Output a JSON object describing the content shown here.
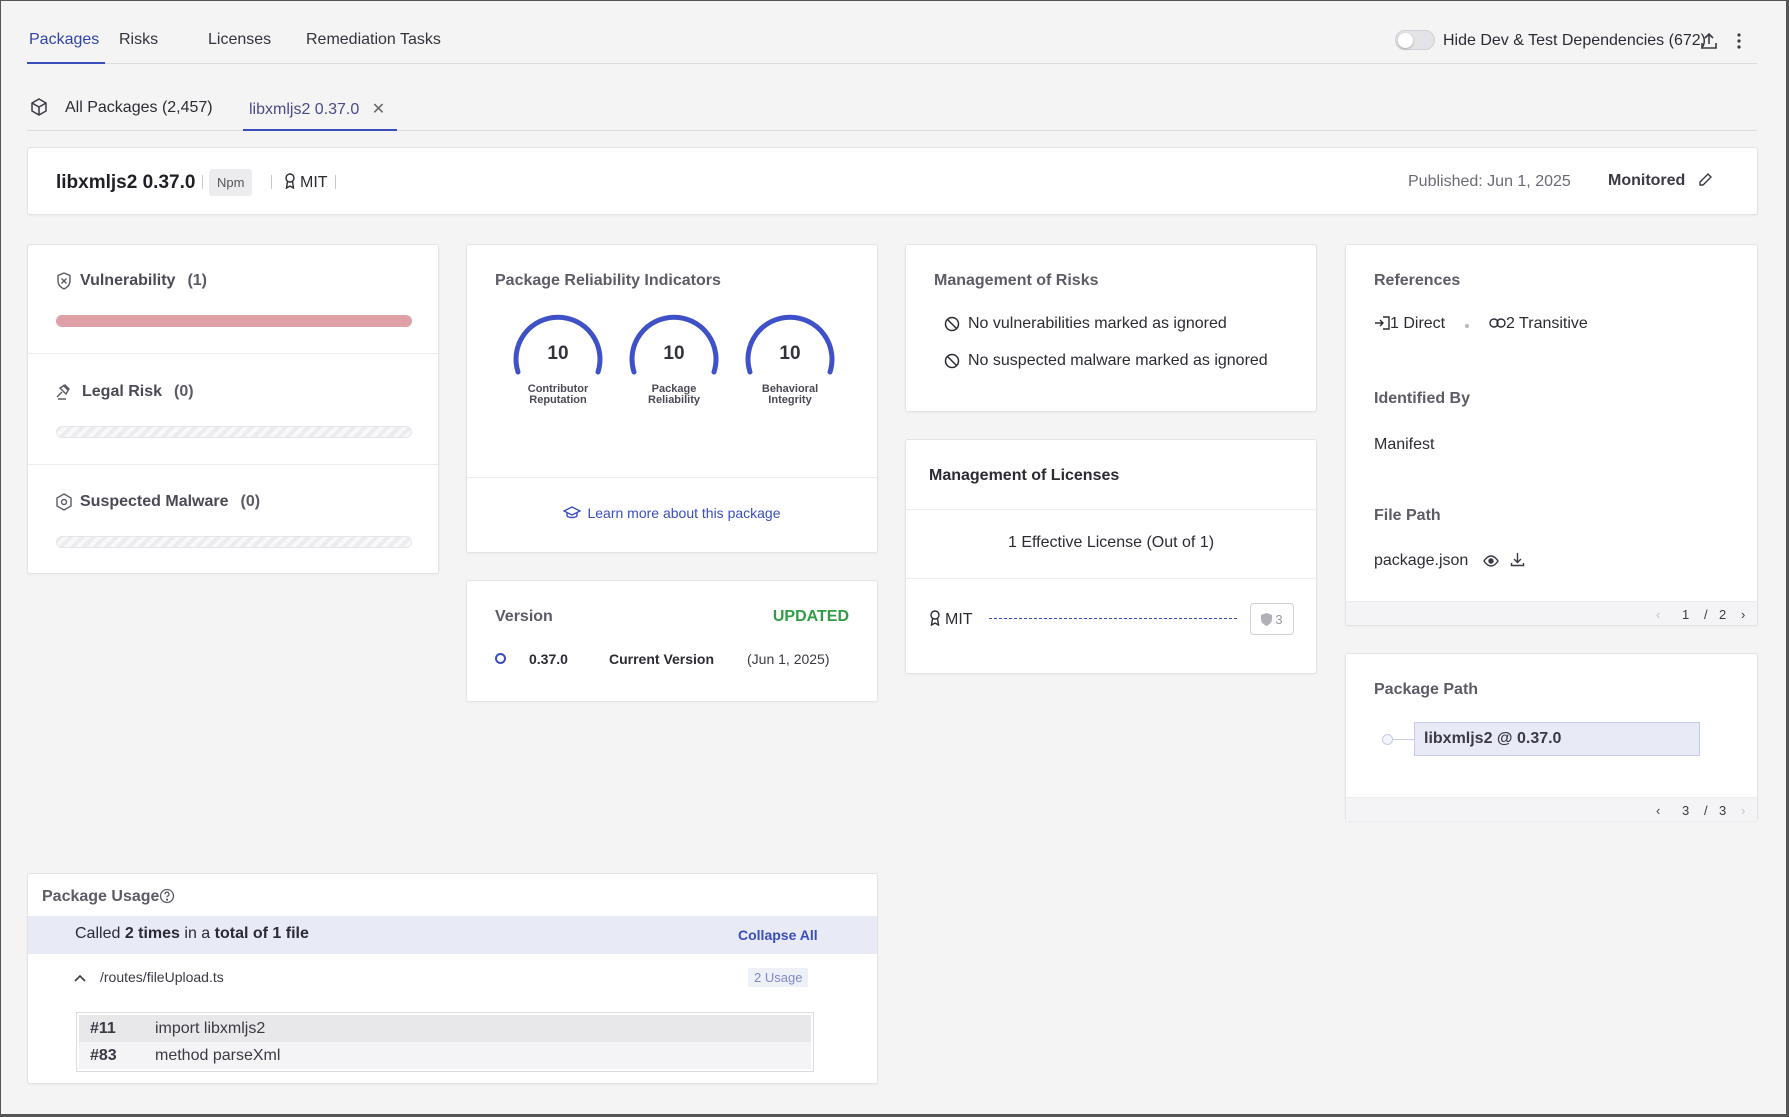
{
  "topnav": {
    "tabs": [
      "Packages",
      "Risks",
      "Licenses",
      "Remediation Tasks"
    ],
    "active_tab": "Packages",
    "toggle_label": "Hide Dev & Test Dependencies (672)",
    "toggle_on": false
  },
  "subtabs": {
    "all_label": "All Packages (2,457)",
    "package_label": "libxmljs2 0.37.0"
  },
  "header": {
    "name": "libxmljs2 0.37.0",
    "ecosystem": "Npm",
    "license": "MIT",
    "published": "Published: Jun 1, 2025",
    "status": "Monitored"
  },
  "risks": {
    "vulnerability": {
      "label": "Vulnerability",
      "count": "(1)"
    },
    "legal": {
      "label": "Legal Risk",
      "count": "(0)"
    },
    "malware": {
      "label": "Suspected Malware",
      "count": "(0)"
    }
  },
  "reliability": {
    "title": "Package Reliability Indicators",
    "gauges": [
      {
        "value": "10",
        "label_line1": "Contributor",
        "label_line2": "Reputation"
      },
      {
        "value": "10",
        "label_line1": "Package",
        "label_line2": "Reliability"
      },
      {
        "value": "10",
        "label_line1": "Behavioral",
        "label_line2": "Integrity"
      }
    ],
    "learn_more": "Learn more about this package"
  },
  "version": {
    "title": "Version",
    "status": "UPDATED",
    "number": "0.37.0",
    "label": "Current Version",
    "date": "(Jun 1, 2025)"
  },
  "management_risks": {
    "title": "Management of Risks",
    "items": [
      "No vulnerabilities marked as ignored",
      "No suspected malware marked as ignored"
    ]
  },
  "management_licenses": {
    "title": "Management of Licenses",
    "effective": "1 Effective License (Out of 1)",
    "license": "MIT",
    "badge_count": "3"
  },
  "references": {
    "title": "References",
    "direct": "1 Direct",
    "transitive": "2 Transitive",
    "identified_by_title": "Identified By",
    "identified_by": "Manifest",
    "file_path_title": "File Path",
    "file_path": "package.json",
    "pager_current": "1",
    "pager_sep": "/",
    "pager_total": "2"
  },
  "package_path": {
    "title": "Package Path",
    "node": "libxmljs2 @ 0.37.0",
    "pager_current": "3",
    "pager_sep": "/",
    "pager_total": "3"
  },
  "usage": {
    "title": "Package Usage",
    "summary_pre": "Called ",
    "summary_times": "2 times",
    "summary_mid": " in a ",
    "summary_files": "total of 1 file",
    "collapse_all": "Collapse All",
    "file": "/routes/fileUpload.ts",
    "usage_badge": "2 Usage",
    "lines": [
      {
        "no": "#11",
        "code": "import libxmljs2"
      },
      {
        "no": "#83",
        "code": "method parseXml"
      }
    ]
  },
  "colors": {
    "accent": "#3b4dbd",
    "updated": "#2f9e44",
    "vuln_bar": "#e0a0a8"
  }
}
